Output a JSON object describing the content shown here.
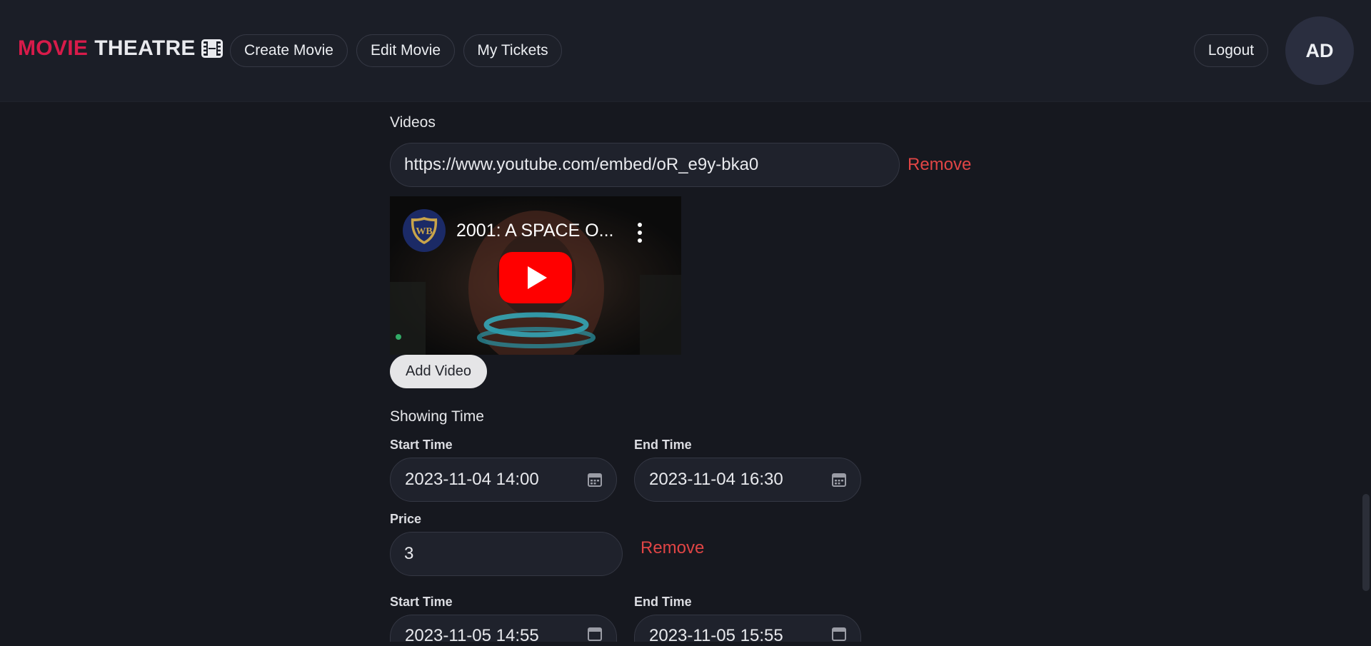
{
  "nav": {
    "brand_word1": "MOVIE",
    "brand_word2": "THEATRE",
    "links": {
      "create_movie": "Create Movie",
      "edit_movie": "Edit Movie",
      "my_tickets": "My Tickets"
    },
    "logout": "Logout",
    "avatar_initials": "AD"
  },
  "videos": {
    "section_label": "Videos",
    "url_value": "https://www.youtube.com/embed/oR_e9y-bka0",
    "remove_label": "Remove",
    "player_title": "2001: A SPACE O...",
    "add_label": "Add Video"
  },
  "showing_time": {
    "section_label": "Showing Time",
    "showings": [
      {
        "start_label": "Start Time",
        "start_value": "2023-11-04 14:00",
        "end_label": "End Time",
        "end_value": "2023-11-04 16:30",
        "price_label": "Price",
        "price_value": "3",
        "remove_label": "Remove"
      },
      {
        "start_label": "Start Time",
        "start_value": "2023-11-05 14:55",
        "end_label": "End Time",
        "end_value": "2023-11-05 15:55"
      }
    ]
  },
  "icons": {
    "brand_icon": "film-icon",
    "calendar_icon": "calendar-icon",
    "play_icon": "play-icon",
    "channel_icon": "wb-shield-icon",
    "more_icon": "kebab-menu-icon"
  },
  "colors": {
    "brand_accent": "#d81b4a",
    "remove_red": "#e04545",
    "youtube_red": "#ff0000",
    "background": "#16181f"
  }
}
